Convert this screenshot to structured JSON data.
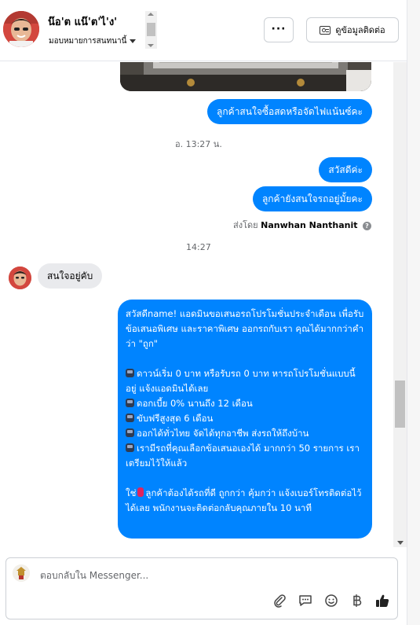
{
  "header": {
    "contact_name": "น๊อ'ต แน๊'ต'ไ'ง'",
    "assign_label": "มอบหมายการสนทนานี้",
    "more_label": "···",
    "contact_info_label": "ดูข้อมูลติดต่อ"
  },
  "thread": {
    "outgoing_1": "ลูกค้าสนใจซื้อสดหรือจัดไฟแน้นซ์คะ",
    "timestamp_1": "อ. 13:27 น.",
    "outgoing_2": "สวัสดีค่ะ",
    "outgoing_3": "ลูกค้ายังสนใจรถอยู่มั้ยคะ",
    "sent_by_prefix": "ส่งโดย",
    "sent_by_name": "Nanwhan Nanthanit",
    "timestamp_2": "14:27",
    "incoming_1": "สนใจอยู่คับ",
    "promo": {
      "intro": "สวัสดีname! แอดมินขอเสนอรถโปรโมชั่นประจำเดือน เพื่อรับข้อเสนอพิเศษ และราคาพิเศษ ออกรถกับเรา คุณได้มากกว่าคำว่า \"ถูก\"",
      "bullets": [
        "ดาวน์เริ่ม 0 บาท หรือรับรถ 0 บาท หารถโปรโมชั่นแบบนี้อยู่ แจ้งแอดมินได้เลย",
        "ดอกเบี้ย 0% นานถึง 12 เดือน",
        "ขับฟรีสูงสุด 6 เดือน",
        "ออกได้ทั่วไทย จัดได้ทุกอาชีพ ส่งรถให้ถึงบ้าน",
        "เรามีรถที่คุณเลือกข้อเสนอเองได้ มากกว่า 50 รายการ เราเตรียมไว้ให้แล้ว"
      ],
      "closing_prefix": "ใช่",
      "closing": "ลูกค้าต้องได้รถที่ดี ถูกกว่า คุ้มกว่า แจ้งเบอร์โทรติดต่อไว้ได้เลย พนักงานจะติดต่อกลับคุณภายใน 10 นาที"
    }
  },
  "composer": {
    "placeholder": "ตอบกลับใน Messenger..."
  },
  "icons": {
    "attach": "paperclip-icon",
    "saved_replies": "chat-bubble-icon",
    "emoji": "smiley-icon",
    "payment": "baht-icon",
    "like": "thumbs-up-icon"
  },
  "colors": {
    "outgoing_bubble": "#0084ff",
    "incoming_bubble": "#e9eaed"
  }
}
